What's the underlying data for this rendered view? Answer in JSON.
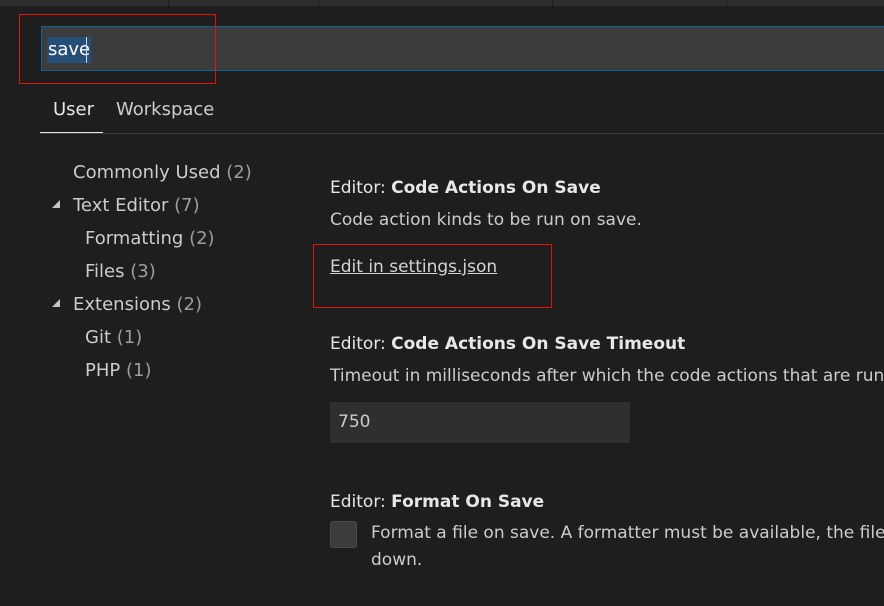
{
  "search": {
    "value": "save"
  },
  "tabs": [
    {
      "label": "User",
      "active": true
    },
    {
      "label": "Workspace",
      "active": false
    }
  ],
  "toc": [
    {
      "label": "Commonly Used",
      "count": "(2)"
    },
    {
      "label": "Text Editor",
      "count": "(7)",
      "expanded": true
    },
    {
      "label": "Formatting",
      "count": "(2)"
    },
    {
      "label": "Files",
      "count": "(3)"
    },
    {
      "label": "Extensions",
      "count": "(2)",
      "expanded": true
    },
    {
      "label": "Git",
      "count": "(1)"
    },
    {
      "label": "PHP",
      "count": "(1)"
    }
  ],
  "settings": {
    "code_actions_on_save": {
      "category": "Editor: ",
      "name": "Code Actions On Save",
      "description": "Code action kinds to be run on save.",
      "link": "Edit in settings.json"
    },
    "code_actions_on_save_timeout": {
      "category": "Editor: ",
      "name": "Code Actions On Save Timeout",
      "description": "Timeout in milliseconds after which the code actions that are run",
      "value": "750"
    },
    "format_on_save": {
      "category": "Editor: ",
      "name": "Format On Save",
      "description_line1": "Format a file on save. A formatter must be available, the file",
      "description_line2": "down.",
      "checked": false
    }
  },
  "colors": {
    "background": "#1e1e1e",
    "input_border": "#0e639c",
    "selection": "#264f78",
    "highlight_box": "#e51400"
  }
}
